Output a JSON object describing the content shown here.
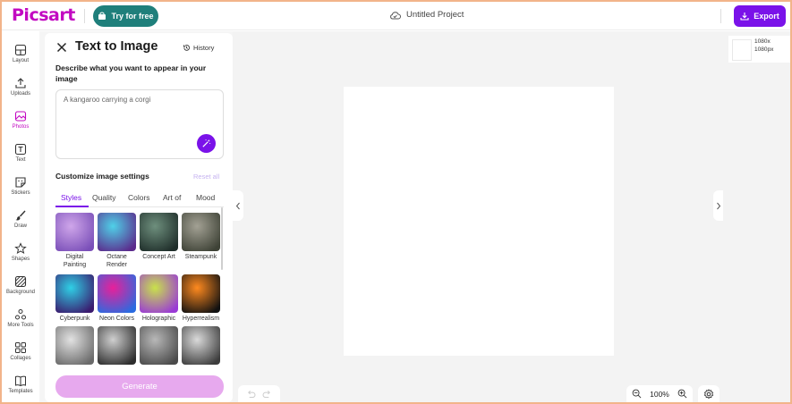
{
  "header": {
    "logo": "Picsart",
    "try_label": "Try for free",
    "project_name": "Untitled Project",
    "export_label": "Export"
  },
  "sidebar": {
    "items": [
      {
        "label": "Layout",
        "icon": "layout-icon"
      },
      {
        "label": "Uploads",
        "icon": "upload-icon"
      },
      {
        "label": "Photos",
        "icon": "photo-icon",
        "active": true
      },
      {
        "label": "Text",
        "icon": "text-icon"
      },
      {
        "label": "Stickers",
        "icon": "sticker-icon"
      },
      {
        "label": "Draw",
        "icon": "brush-icon"
      },
      {
        "label": "Shapes",
        "icon": "star-icon"
      },
      {
        "label": "Background",
        "icon": "background-icon"
      },
      {
        "label": "More Tools",
        "icon": "more-tools-icon"
      },
      {
        "label": "Collages",
        "icon": "collage-icon"
      },
      {
        "label": "Templates",
        "icon": "template-icon"
      }
    ]
  },
  "panel": {
    "title": "Text to Image",
    "history_label": "History",
    "describe_label": "Describe what you want to appear in your image",
    "prompt_value": "A kangaroo carrying a corgi",
    "customize_label": "Customize image settings",
    "reset_label": "Reset all",
    "tabs": [
      "Styles",
      "Quality",
      "Colors",
      "Art of",
      "Mood"
    ],
    "styles": [
      {
        "label": "Digital Painting",
        "colors": [
          "#cfa6ea",
          "#7a4fb8"
        ]
      },
      {
        "label": "Octane Render",
        "colors": [
          "#4fd1e8",
          "#5b2a8c"
        ]
      },
      {
        "label": "Concept Art",
        "colors": [
          "#6e8f7d",
          "#1f2e2a"
        ]
      },
      {
        "label": "Steampunk",
        "colors": [
          "#a3a194",
          "#3e4236"
        ]
      },
      {
        "label": "Cyberpunk",
        "colors": [
          "#2fd0e6",
          "#3a1a6e"
        ]
      },
      {
        "label": "Neon Colors",
        "colors": [
          "#e8209a",
          "#2a6be0"
        ]
      },
      {
        "label": "Holographic",
        "colors": [
          "#c9e24a",
          "#9a3ad6"
        ]
      },
      {
        "label": "Hyperrealism",
        "colors": [
          "#ff8a1f",
          "#111111"
        ]
      },
      {
        "label": "",
        "colors": [
          "#e2e2e2",
          "#6a6a6a"
        ]
      },
      {
        "label": "",
        "colors": [
          "#cfcfcf",
          "#2d2d2d"
        ]
      },
      {
        "label": "",
        "colors": [
          "#b8b8b8",
          "#4a4a4a"
        ]
      },
      {
        "label": "",
        "colors": [
          "#dadada",
          "#3c3c3c"
        ]
      }
    ],
    "generate_label": "Generate"
  },
  "canvas": {
    "zoom": "100%"
  },
  "pages": {
    "size_line1": "1080x",
    "size_line2": "1080px"
  },
  "colors": {
    "brand": "#c209c1",
    "accent": "#7a12e9",
    "try_button": "#1f7f7b",
    "generate_disabled": "#e7a9ee"
  }
}
